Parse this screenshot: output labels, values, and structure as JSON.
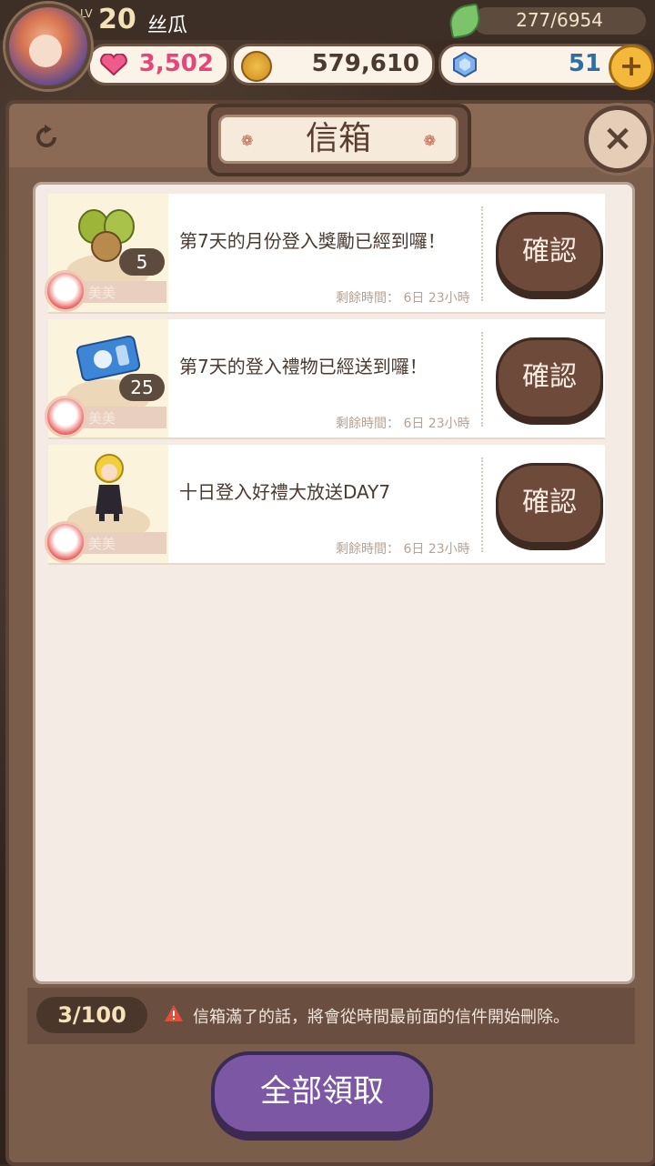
{
  "player": {
    "lv_label": "LV",
    "level": "20",
    "name": "丝瓜",
    "stamina": "277/6954"
  },
  "resources": {
    "hearts": "3,502",
    "gold": "579,610",
    "gems": "51",
    "plus_label": "+"
  },
  "mailbox": {
    "title": "信箱",
    "close_label": "×",
    "items": [
      {
        "message": "第7天的月份登入獎勵已經到囉！",
        "count": "5",
        "sender": "美美",
        "time_remaining": "剩餘時間： 6日 23小時",
        "confirm_label": "確認",
        "item_icon": "seed-icon"
      },
      {
        "message": "第7天的登入禮物已經送到囉！",
        "count": "25",
        "sender": "美美",
        "time_remaining": "剩餘時間： 6日 23小時",
        "confirm_label": "確認",
        "item_icon": "ticket-icon"
      },
      {
        "message": "十日登入好禮大放送DAY7",
        "count": "",
        "sender": "美美",
        "time_remaining": "剩餘時間： 6日 23小時",
        "confirm_label": "確認",
        "item_icon": "character-costume-icon"
      }
    ],
    "mail_count": "3/100",
    "warning": "信箱滿了的話，將會從時間最前面的信件開始刪除。",
    "claim_all_label": "全部領取"
  },
  "colors": {
    "heart": "#e6457a",
    "gold_text": "#4a3a30",
    "gem_text": "#2f6ea4",
    "confirm_bg": "#6e4a3a",
    "claim_bg": "#7c58a4"
  }
}
